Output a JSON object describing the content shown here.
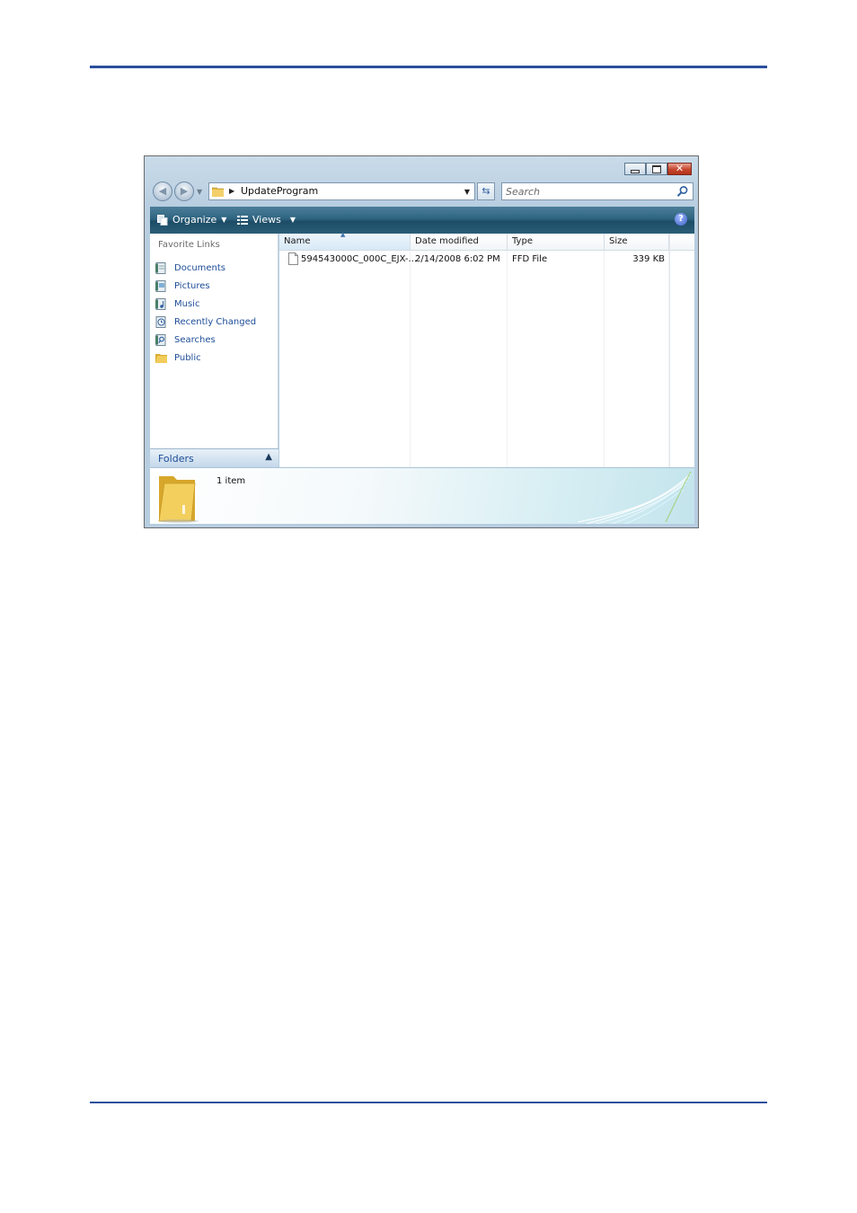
{
  "window": {
    "address_path": "UpdateProgram",
    "search_placeholder": "Search"
  },
  "toolbar": {
    "organize_label": "Organize",
    "views_label": "Views"
  },
  "nav_pane": {
    "title": "Favorite Links",
    "items": [
      {
        "label": "Documents",
        "icon": "documents-icon"
      },
      {
        "label": "Pictures",
        "icon": "pictures-icon"
      },
      {
        "label": "Music",
        "icon": "music-icon"
      },
      {
        "label": "Recently Changed",
        "icon": "recently-changed-icon"
      },
      {
        "label": "Searches",
        "icon": "searches-icon"
      },
      {
        "label": "Public",
        "icon": "folder-icon"
      }
    ],
    "folders_label": "Folders"
  },
  "file_list": {
    "columns": [
      "Name",
      "Date modified",
      "Type",
      "Size"
    ],
    "rows": [
      {
        "name": "594543000C_000C_EJX-...",
        "date": "2/14/2008 6:02 PM",
        "type": "FFD File",
        "size": "339 KB"
      }
    ]
  },
  "details": {
    "count": "1 item"
  },
  "colors": {
    "accent_rule": "#2b4f9e",
    "link_text": "#1d4d98",
    "command_bar": "#2f6480"
  }
}
